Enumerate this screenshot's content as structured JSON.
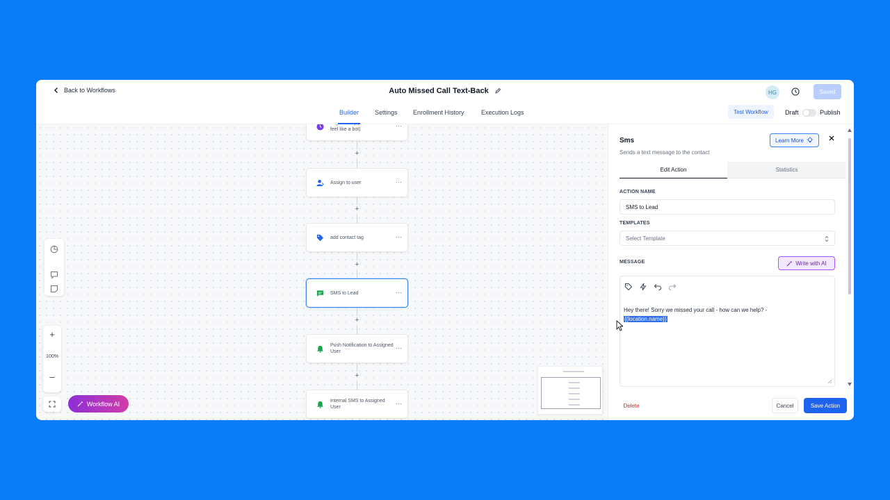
{
  "header": {
    "back_label": "Back to Workflows",
    "title": "Auto Missed Call Text-Back",
    "avatar_initials": "HG",
    "saved_label": "Saved"
  },
  "tabs": [
    {
      "label": "Builder",
      "active": true
    },
    {
      "label": "Settings",
      "active": false
    },
    {
      "label": "Enrollment History",
      "active": false
    },
    {
      "label": "Execution Logs",
      "active": false
    }
  ],
  "actions": {
    "test_label": "Test Workflow",
    "draft_label": "Draft",
    "publish_label": "Publish",
    "published": false
  },
  "canvas": {
    "nodes": [
      {
        "label": "Slight Delay (so SMS doesn't feel like a bot)",
        "icon": "clock-icon",
        "color": "#7c3aed",
        "selected": false
      },
      {
        "label": "Assign to user",
        "icon": "user-icon",
        "color": "#2563eb",
        "selected": false
      },
      {
        "label": "add contact tag",
        "icon": "tag-icon",
        "color": "#2563eb",
        "selected": false
      },
      {
        "label": "SMS to Lead",
        "icon": "message-icon",
        "color": "#16a34a",
        "selected": true
      },
      {
        "label": "Push Notification to Assigned User",
        "icon": "bell-icon",
        "color": "#16a34a",
        "selected": false
      },
      {
        "label": "Internal SMS to Assigned User",
        "icon": "bell-icon",
        "color": "#16a34a",
        "selected": false
      }
    ],
    "zoom": "100%",
    "ai_button_label": "Workflow AI"
  },
  "panel": {
    "title": "Sms",
    "subtitle": "Sends a text message to the contact",
    "learn_more_label": "Learn More",
    "tab_edit": "Edit Action",
    "tab_stats": "Statistics",
    "action_name_label": "ACTION NAME",
    "action_name_value": "SMS to Lead",
    "templates_label": "TEMPLATES",
    "templates_placeholder": "Select Template",
    "message_label": "MESSAGE",
    "write_ai_label": "Write with AI",
    "message_text": "Hey there! Sorry we missed your call - how can we help? -",
    "message_variable": "{{location.name}}",
    "delete_label": "Delete",
    "cancel_label": "Cancel",
    "save_label": "Save Action"
  }
}
